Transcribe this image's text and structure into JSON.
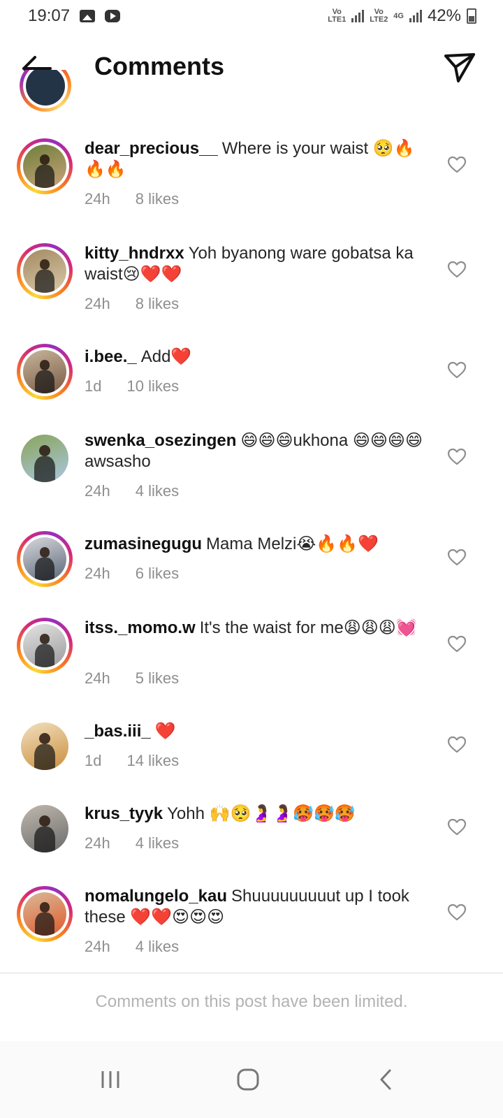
{
  "status_bar": {
    "time": "19:07",
    "battery": "42%",
    "sim1_tag": "Vo LTE1",
    "sim2_tag": "Vo LTE2",
    "net_tag": "4G",
    "icons": [
      "gallery-icon",
      "youtube-icon",
      "signal-icon",
      "battery-icon"
    ]
  },
  "header": {
    "title": "Comments",
    "back_icon": "arrow-left-icon",
    "share_icon": "paper-plane-icon"
  },
  "comments": [
    {
      "username": "dear_precious__",
      "text": "Where is your waist 🥺🔥🔥🔥",
      "time": "24h",
      "likes": "8 likes",
      "story": true,
      "avatar_colors": [
        "#c9a37a",
        "#6e7f3a"
      ]
    },
    {
      "username": "kitty_hndrxx",
      "text": "Yoh byanong ware gobatsa ka waist😢❤️❤️",
      "time": "24h",
      "likes": "8 likes",
      "story": true,
      "avatar_colors": [
        "#d9c9a8",
        "#a38a63"
      ]
    },
    {
      "username": "i.bee._",
      "text": "Add❤️",
      "time": "1d",
      "likes": "10 likes",
      "story": true,
      "avatar_colors": [
        "#7a5a44",
        "#c7b59c"
      ]
    },
    {
      "username": "swenka_osezingen",
      "text": "😄😄😄ukhona 😄😄😄😄awsasho",
      "time": "24h",
      "likes": "4 likes",
      "story": false,
      "avatar_colors": [
        "#a9c7e0",
        "#8aa45c"
      ]
    },
    {
      "username": "zumasinegugu",
      "text": "Mama Melzi😭🔥🔥❤️",
      "time": "24h",
      "likes": "6 likes",
      "story": true,
      "avatar_colors": [
        "#5a6678",
        "#d8d8dc"
      ]
    },
    {
      "username": "itss._momo.w",
      "text": "It's the waist for me😩😩😩💓",
      "time": "24h",
      "likes": "5 likes",
      "story": true,
      "avatar_colors": [
        "#9a9a9a",
        "#e3e3e3"
      ]
    },
    {
      "username": "_bas.iii_",
      "text": "❤️",
      "time": "1d",
      "likes": "14 likes",
      "story": false,
      "avatar_colors": [
        "#c98d3a",
        "#f2e0c0"
      ]
    },
    {
      "username": "krus_tyyk",
      "text": "Yohh 🙌🥺🤰🤰🥵🥵🥵",
      "time": "24h",
      "likes": "4 likes",
      "story": false,
      "avatar_colors": [
        "#6b6b6b",
        "#bfb8ad"
      ]
    },
    {
      "username": "nomalungelo_kau",
      "text": "Shuuuuuuuuut up I took these ❤️❤️😍😍😍",
      "time": "24h",
      "likes": "4 likes",
      "story": true,
      "avatar_colors": [
        "#e05a2a",
        "#d9b99a"
      ]
    }
  ],
  "footer": {
    "limited_notice": "Comments on this post have been limited."
  },
  "navbar": {
    "recent_icon": "recent-apps-icon",
    "home_icon": "home-icon",
    "back_icon": "back-chevron-icon"
  }
}
